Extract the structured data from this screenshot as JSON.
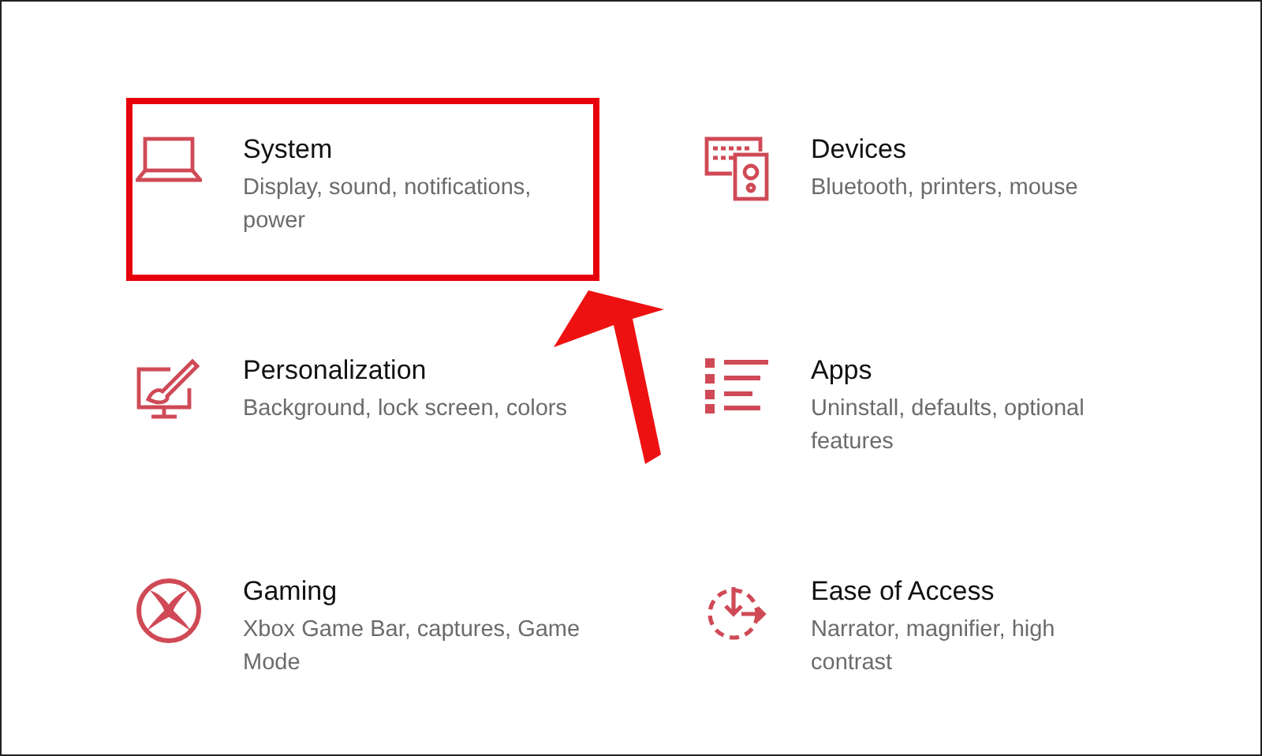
{
  "settings": [
    {
      "kind": "system",
      "title": "System",
      "description": "Display, sound, notifications, power",
      "highlighted": true
    },
    {
      "kind": "devices",
      "title": "Devices",
      "description": "Bluetooth, printers, mouse",
      "highlighted": false
    },
    {
      "kind": "personalization",
      "title": "Personalization",
      "description": "Background, lock screen, colors",
      "highlighted": false
    },
    {
      "kind": "apps",
      "title": "Apps",
      "description": "Uninstall, defaults, optional features",
      "highlighted": false
    },
    {
      "kind": "gaming",
      "title": "Gaming",
      "description": "Xbox Game Bar, captures, Game Mode",
      "highlighted": false
    },
    {
      "kind": "ease",
      "title": "Ease of Access",
      "description": "Narrator, magnifier, high contrast",
      "highlighted": false
    }
  ],
  "annotation": {
    "arrow": true
  }
}
